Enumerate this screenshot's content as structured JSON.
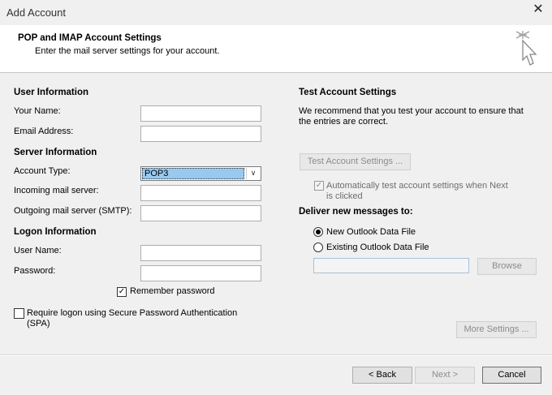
{
  "window": {
    "title": "Add Account",
    "close_glyph": "✕"
  },
  "header": {
    "title": "POP and IMAP Account Settings",
    "subtitle": "Enter the mail server settings for your account."
  },
  "user_info": {
    "heading": "User Information",
    "your_name_label": "Your Name:",
    "your_name_value": "",
    "email_label": "Email Address:",
    "email_value": ""
  },
  "server_info": {
    "heading": "Server Information",
    "account_type_label": "Account Type:",
    "account_type_value": "POP3",
    "incoming_label": "Incoming mail server:",
    "incoming_value": "",
    "outgoing_label": "Outgoing mail server (SMTP):",
    "outgoing_value": ""
  },
  "logon_info": {
    "heading": "Logon Information",
    "username_label": "User Name:",
    "username_value": "",
    "password_label": "Password:",
    "password_value": "",
    "remember_label": "Remember password",
    "remember_checked": true,
    "spa_label_line1": "Require logon using Secure Password Authentication",
    "spa_label_line2": "(SPA)",
    "spa_checked": false
  },
  "test_settings": {
    "heading": "Test Account Settings",
    "desc_line1": "We recommend that you test your account to ensure that",
    "desc_line2": "the entries are correct.",
    "test_button": "Test Account Settings ...",
    "auto_test_line1": "Automatically test account settings when Next",
    "auto_test_line2": "is clicked",
    "auto_test_checked": true
  },
  "deliver": {
    "heading": "Deliver new messages to:",
    "new_file_label": "New Outlook Data File",
    "existing_file_label": "Existing Outlook Data File",
    "selected": "new",
    "existing_path": "",
    "browse_button": "Browse"
  },
  "more_settings_button": "More Settings ...",
  "footer": {
    "back_button": "< Back",
    "next_button": "Next >",
    "cancel_button": "Cancel"
  },
  "check_glyph": "✓",
  "dropdown_glyph": "∨"
}
